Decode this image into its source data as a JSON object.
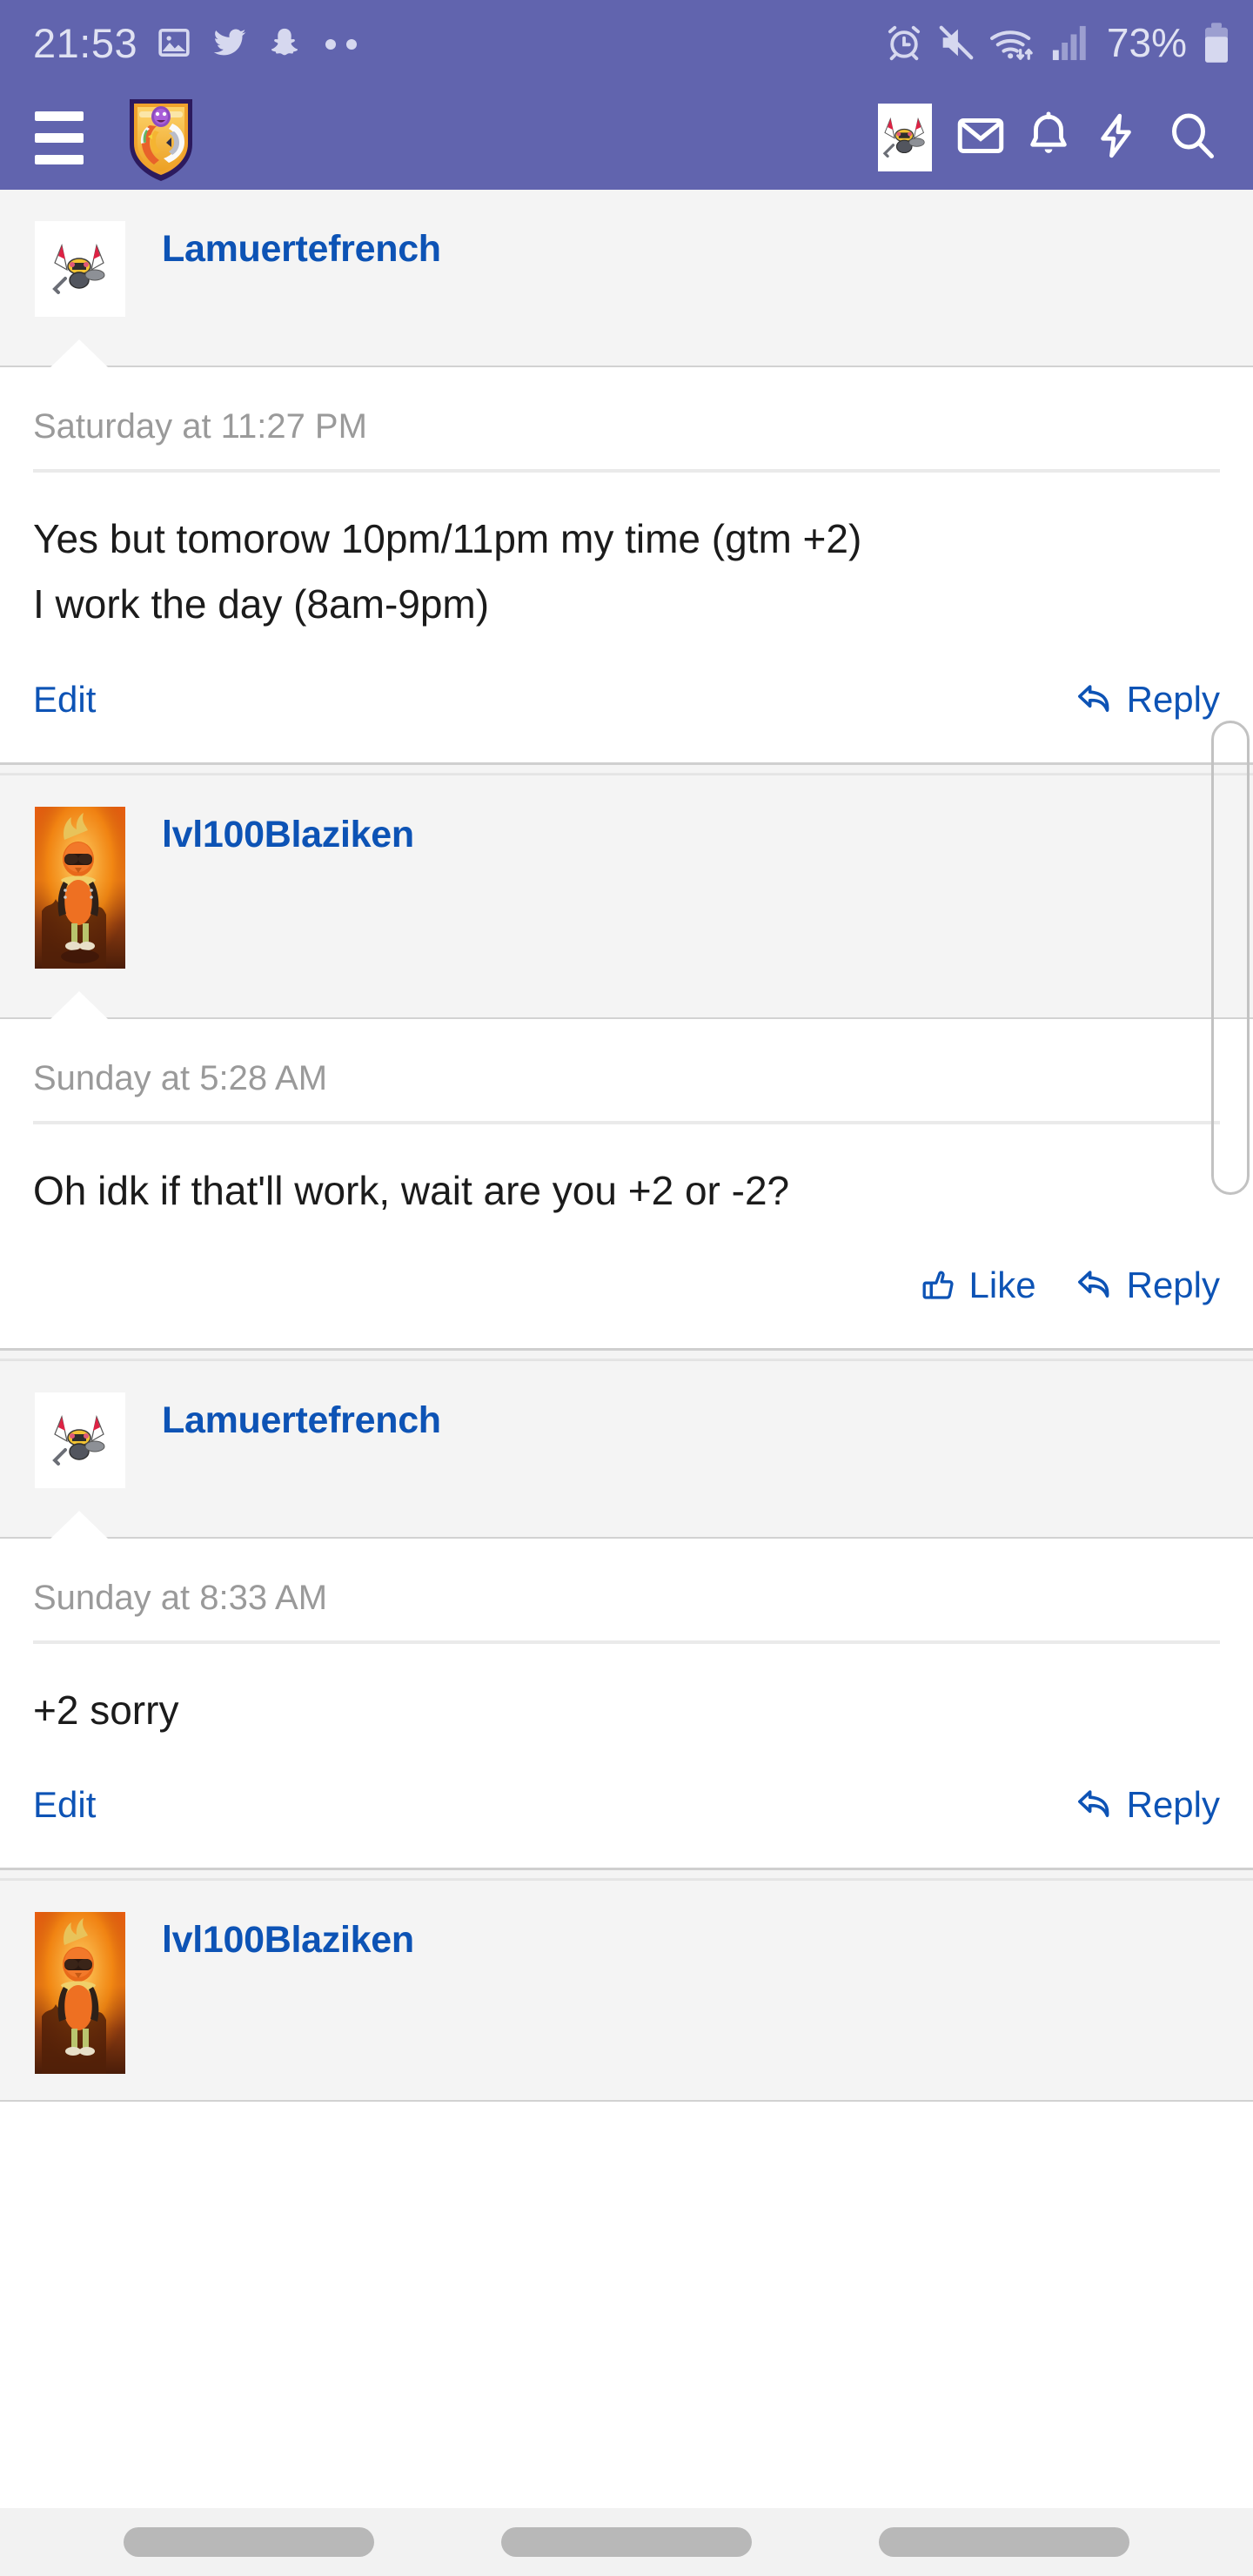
{
  "statusbar": {
    "time": "21:53",
    "battery_percent": "73%",
    "left_icons": [
      "photo-icon",
      "twitter-icon",
      "snapchat-icon",
      "more-dots-icon"
    ],
    "right_icons": [
      "alarm-icon",
      "mute-icon",
      "wifi-icon",
      "signal-icon",
      "battery-icon"
    ],
    "accent": "#6164ae",
    "icon_color": "#d6d8ef"
  },
  "navbar": {
    "menu_icon": "hamburger-icon",
    "logo_icon": "forum-shield-logo",
    "items": [
      {
        "icon": "user-avatar-icon",
        "name": "account-avatar"
      },
      {
        "icon": "envelope-icon",
        "name": "inbox-button"
      },
      {
        "icon": "bell-icon",
        "name": "alerts-button"
      },
      {
        "icon": "bolt-icon",
        "name": "whats-new-button"
      },
      {
        "icon": "search-icon",
        "name": "search-button"
      }
    ],
    "background": "#6164ae"
  },
  "thread": {
    "link_color": "#0d53b5",
    "posts": [
      {
        "username": "Lamuertefrench",
        "avatar": "beedrill",
        "date": "Saturday at 11:27 PM",
        "lines": [
          "Yes but tomorow 10pm/11pm my time (gtm +2)",
          "I work the day (8am-9pm)"
        ],
        "actions": {
          "left": "Edit",
          "like": null,
          "reply": "Reply"
        }
      },
      {
        "username": "lvl100Blaziken",
        "avatar": "blaziken",
        "date": "Sunday at 5:28 AM",
        "lines": [
          "Oh idk if that'll work, wait are you +2 or -2?"
        ],
        "actions": {
          "left": null,
          "like": "Like",
          "reply": "Reply"
        }
      },
      {
        "username": "Lamuertefrench",
        "avatar": "beedrill",
        "date": "Sunday at 8:33 AM",
        "lines": [
          "+2 sorry"
        ],
        "actions": {
          "left": "Edit",
          "like": null,
          "reply": "Reply"
        }
      },
      {
        "username": "lvl100Blaziken",
        "avatar": "blaziken",
        "date": "",
        "lines": [],
        "actions": {
          "left": null,
          "like": null,
          "reply": null
        }
      }
    ]
  },
  "androidnav": {
    "buttons": [
      "recents-button",
      "home-button",
      "back-button"
    ]
  }
}
